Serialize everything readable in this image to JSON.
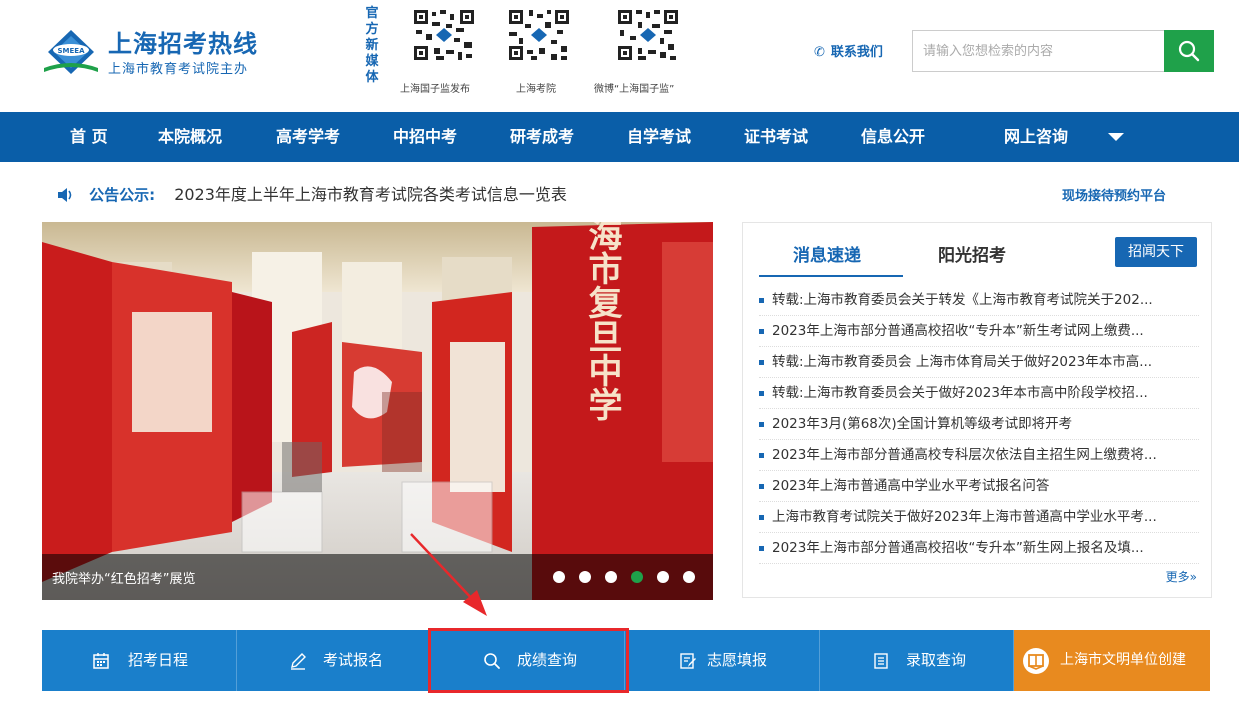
{
  "header": {
    "logo_badge": "SMEEA",
    "logo_title": "上海招考热线",
    "logo_subtitle": "上海市教育考试院主办",
    "media_label": "官方新媒体",
    "qr_codes": [
      {
        "caption": "上海国子监发布"
      },
      {
        "caption": "上海考院"
      },
      {
        "caption": "微博“上海国子监”"
      }
    ],
    "contact_label": "联系我们",
    "search": {
      "placeholder": "请输入您想检索的内容",
      "value": ""
    },
    "colors": {
      "brand_blue": "#1767b3",
      "search_green": "#1fa14a"
    }
  },
  "nav": {
    "items": [
      "首 页",
      "本院概况",
      "高考学考",
      "中招中考",
      "研考成考",
      "自学考试",
      "证书考试",
      "信息公开",
      "网上咨询"
    ],
    "color": "#0a5ea8"
  },
  "notice": {
    "label": "公告公示:",
    "text": "2023年度上半年上海市教育考试院各类考试信息一览表",
    "reception_link": "现场接待预约平台"
  },
  "banner": {
    "caption": "我院举办“红色招考”展览",
    "image_text": "上海市复旦中学",
    "slide_count": 6,
    "active_slide": 4
  },
  "news": {
    "tabs": [
      "消息速递",
      "阳光招考"
    ],
    "active_tab": 0,
    "tab_button": "招闻天下",
    "items": [
      "转载:上海市教育委员会关于转发《上海市教育考试院关于202...",
      "2023年上海市部分普通高校招收“专升本”新生考试网上缴费...",
      "转载:上海市教育委员会 上海市体育局关于做好2023年本市高...",
      "转载:上海市教育委员会关于做好2023年本市高中阶段学校招...",
      "2023年3月(第68次)全国计算机等级考试即将开考",
      "2023年上海市部分普通高校专科层次依法自主招生网上缴费将...",
      "2023年上海市普通高中学业水平考试报名问答",
      "上海市教育考试院关于做好2023年上海市普通高中学业水平考...",
      "2023年上海市部分普通高校招收“专升本”新生网上报名及填..."
    ],
    "more": "更多»"
  },
  "bottom_bar": {
    "items": [
      {
        "label": "招考日程",
        "icon": "calendar-icon"
      },
      {
        "label": "考试报名",
        "icon": "pencil-icon"
      },
      {
        "label": "成绩查询",
        "icon": "search-icon"
      },
      {
        "label": "志愿填报",
        "icon": "form-icon"
      },
      {
        "label": "录取查询",
        "icon": "list-icon"
      },
      {
        "label": "上海市文明单位创建",
        "icon": "book-icon"
      }
    ],
    "highlighted": "成绩查询",
    "colors": {
      "blue": "#1a7fcb",
      "orange": "#e88a1f",
      "highlight": "#e8282b"
    }
  }
}
